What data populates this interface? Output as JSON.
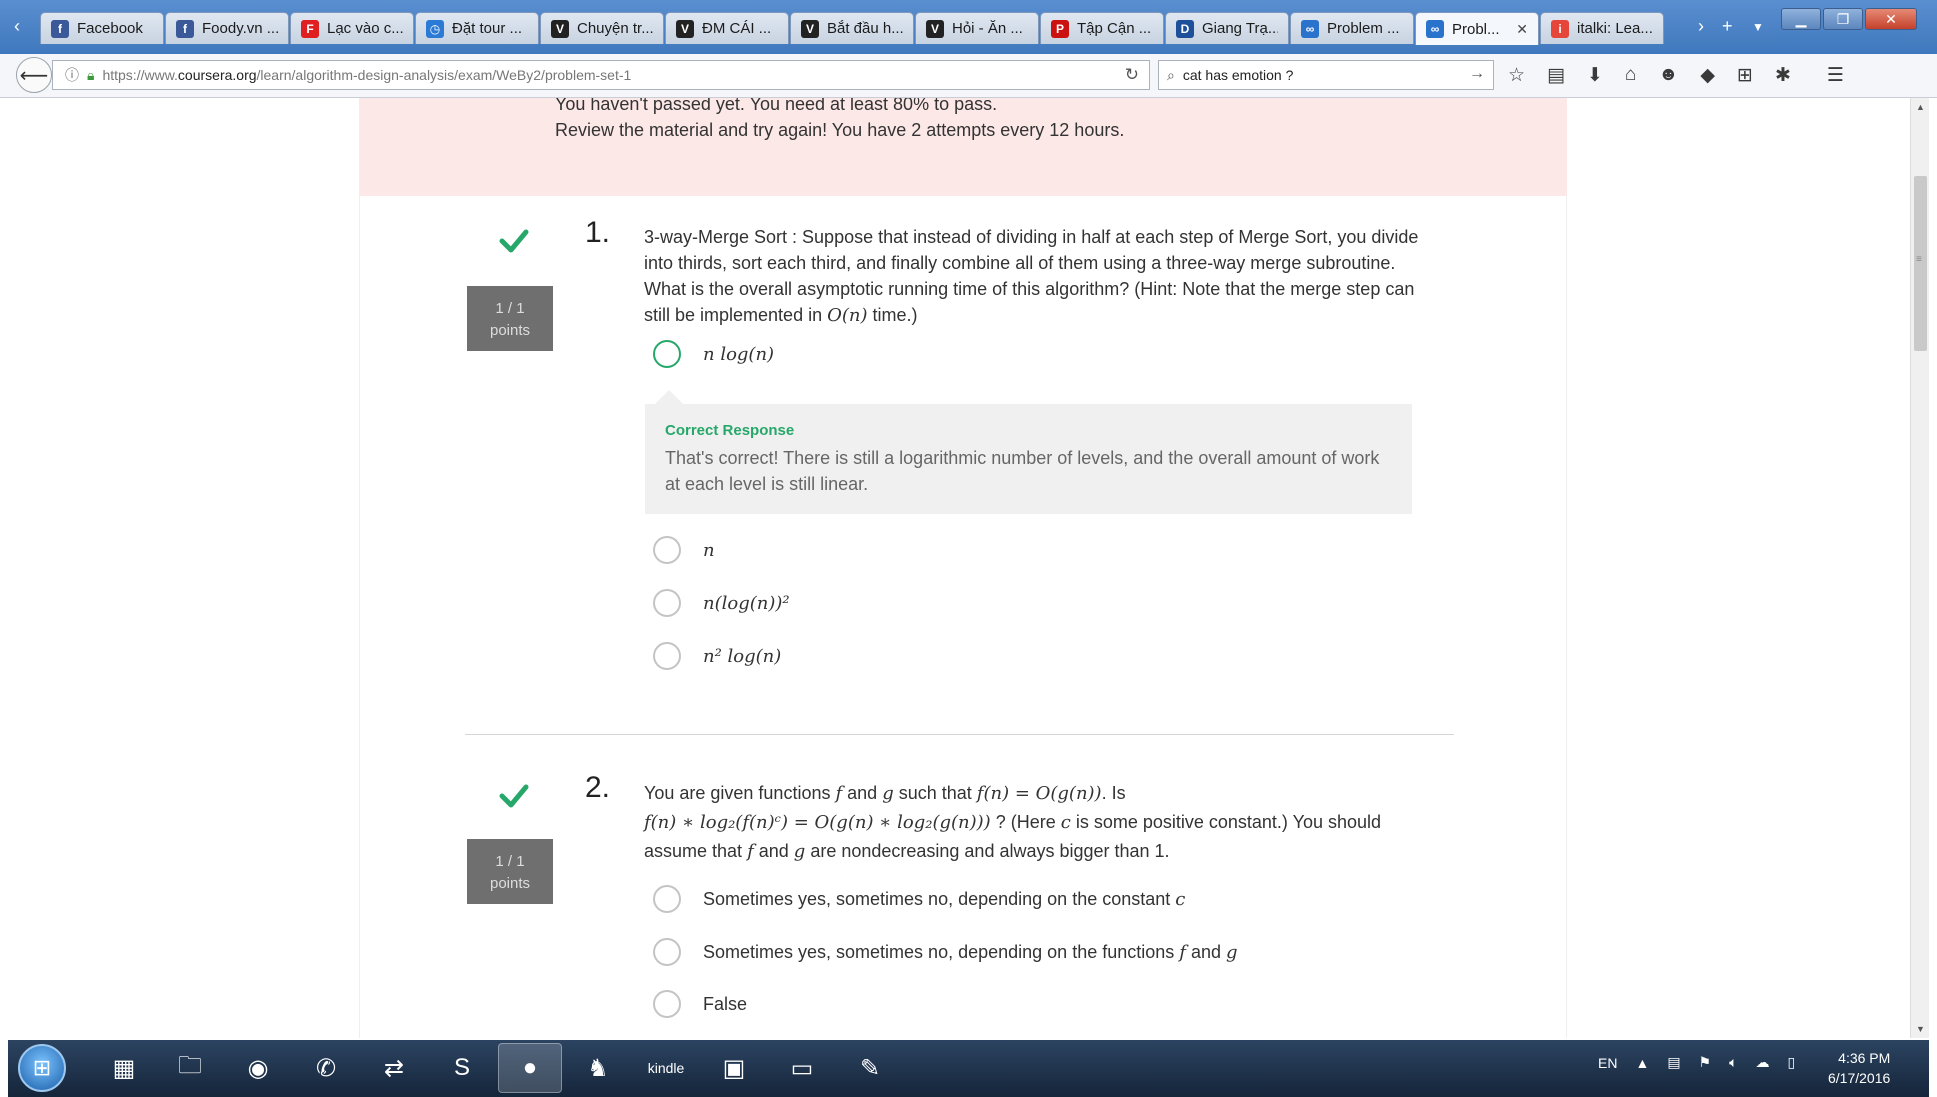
{
  "browser": {
    "tabs": [
      {
        "label": "Facebook",
        "icon": "facebook-icon",
        "color": "#3b5998",
        "glyph": "f"
      },
      {
        "label": "Foody.vn ...",
        "icon": "facebook-icon",
        "color": "#3b5998",
        "glyph": "f"
      },
      {
        "label": "Lạc vào c...",
        "icon": "f-logo-icon",
        "color": "#e02020",
        "glyph": "F"
      },
      {
        "label": "Đặt tour ...",
        "icon": "clock-icon",
        "color": "#2a7ad6",
        "glyph": "◷"
      },
      {
        "label": "Chuyện tr...",
        "icon": "v-logo-icon",
        "color": "#222222",
        "glyph": "V"
      },
      {
        "label": "ĐM CÁI ...",
        "icon": "v-logo-icon",
        "color": "#222222",
        "glyph": "V"
      },
      {
        "label": "Bắt đầu h...",
        "icon": "v-logo-icon",
        "color": "#222222",
        "glyph": "V"
      },
      {
        "label": "Hỏi - Ăn ...",
        "icon": "v-logo-icon",
        "color": "#222222",
        "glyph": "V"
      },
      {
        "label": "Tập Cận ...",
        "icon": "p-logo-icon",
        "color": "#cc1111",
        "glyph": "P"
      },
      {
        "label": "Giang Trạ...",
        "icon": "dkn-logo-icon",
        "color": "#1d4f9a",
        "glyph": "D"
      },
      {
        "label": "Problem ...",
        "icon": "coursera-icon",
        "color": "#2a73cc",
        "glyph": "∞"
      },
      {
        "label": "Probl...",
        "icon": "coursera-icon",
        "color": "#2a73cc",
        "glyph": "∞",
        "active": true
      },
      {
        "label": "italki: Lea...",
        "icon": "italki-icon",
        "color": "#e6453a",
        "glyph": "i"
      }
    ],
    "url_prefix": "https://www.",
    "url_domain": "coursera.org",
    "url_path": "/learn/algorithm-design-analysis/exam/WeBy2/problem-set-1",
    "search_value": "cat has emotion ?"
  },
  "banner": {
    "line1": "You haven't passed yet. You need at least 80% to pass.",
    "line2": "Review the material and try again!  You have 2 attempts every 12 hours."
  },
  "questions": [
    {
      "number": "1.",
      "score": "1 / 1",
      "score_unit": "points",
      "text_a": "3-way-Merge Sort : Suppose that instead of dividing in half at each step of Merge Sort, you divide into thirds, sort each third, and finally combine all of them using a three-way merge subroutine. What is the overall asymptotic running time of this algorithm? (Hint: Note that the merge step can still be implemented in ",
      "text_math": "O(n)",
      "text_b": " time.)",
      "feedback_title": "Correct Response",
      "feedback_body": "That's correct! There is still a logarithmic number of levels, and the overall amount of work at each level is still linear.",
      "options": [
        "n log(n)",
        "n",
        "n(log(n))²",
        "n² log(n)"
      ]
    },
    {
      "number": "2.",
      "score": "1 / 1",
      "score_unit": "points",
      "line1_a": "You are given functions ",
      "line1_f": "f",
      "line1_and": " and ",
      "line1_g": "g",
      "line1_b": " such that ",
      "line1_math": "f(n) = O(g(n))",
      "line1_c": ". Is",
      "line2_math": "f(n) ∗ log₂(f(n)ᶜ) = O(g(n) ∗ log₂(g(n)))",
      "line2_b": " ? (Here ",
      "line2_c": "c",
      "line2_d": " is some positive constant.) You should",
      "line3_a": "assume that ",
      "line3_f": "f",
      "line3_and": " and ",
      "line3_g": "g",
      "line3_b": " are nondecreasing and always bigger than 1.",
      "options": [
        {
          "text": "Sometimes yes, sometimes no, depending on the constant ",
          "math": "c"
        },
        {
          "text": "Sometimes yes, sometimes no, depending on the functions ",
          "math": "f",
          "mid": " and ",
          "math2": "g"
        },
        {
          "text": "False"
        }
      ]
    }
  ],
  "taskbar": {
    "lang": "EN",
    "time": "4:36 PM",
    "date": "6/17/2016"
  },
  "colors": {
    "correct": "#27a86a",
    "banner_bg": "#fde8e8",
    "points_bg": "#6f6f6f"
  }
}
